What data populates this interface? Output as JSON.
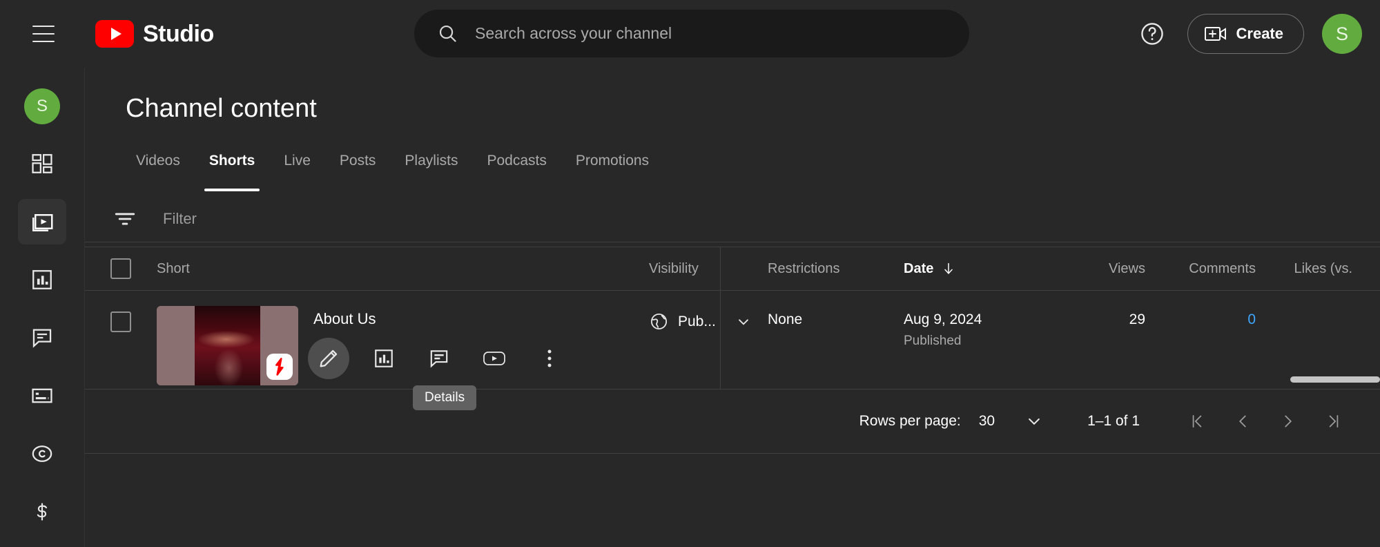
{
  "app": {
    "brand_name": "Studio",
    "hamburger_label": "Guide menu"
  },
  "search": {
    "placeholder": "Search across your channel",
    "value": ""
  },
  "header_actions": {
    "help_label": "Help",
    "create_label": "Create",
    "avatar_initial": "S"
  },
  "rail": {
    "avatar_initial": "S",
    "items": [
      {
        "name": "dashboard",
        "label": "Dashboard",
        "active": false
      },
      {
        "name": "content",
        "label": "Content",
        "active": true
      },
      {
        "name": "analytics",
        "label": "Analytics",
        "active": false
      },
      {
        "name": "comments",
        "label": "Comments",
        "active": false
      },
      {
        "name": "subtitles",
        "label": "Subtitles",
        "active": false
      },
      {
        "name": "copyright",
        "label": "Copyright",
        "active": false
      },
      {
        "name": "earn",
        "label": "Earn",
        "active": false
      }
    ]
  },
  "page": {
    "title": "Channel content"
  },
  "tabs": [
    {
      "label": "Videos",
      "active": false
    },
    {
      "label": "Shorts",
      "active": true
    },
    {
      "label": "Live",
      "active": false
    },
    {
      "label": "Posts",
      "active": false
    },
    {
      "label": "Playlists",
      "active": false
    },
    {
      "label": "Podcasts",
      "active": false
    },
    {
      "label": "Promotions",
      "active": false
    }
  ],
  "filter": {
    "placeholder": "Filter",
    "value": ""
  },
  "table": {
    "columns": {
      "short": "Short",
      "visibility": "Visibility",
      "restrictions": "Restrictions",
      "date": "Date",
      "views": "Views",
      "comments": "Comments",
      "likes": "Likes (vs."
    },
    "sort": {
      "column": "Date",
      "direction": "descending"
    },
    "rows": [
      {
        "title": "About Us",
        "visibility": "Pub...",
        "visibility_full": "Public",
        "restrictions": "None",
        "date": "Aug 9, 2024",
        "date_status": "Published",
        "views": "29",
        "comments": "0",
        "selected": false,
        "actions": [
          "details",
          "analytics",
          "comments",
          "watch-on-youtube",
          "more-options"
        ]
      }
    ]
  },
  "tooltip": {
    "text": "Details"
  },
  "pagination": {
    "rows_per_page_label": "Rows per page:",
    "rows_per_page_value": "30",
    "range": "1–1 of 1",
    "first_label": "First page",
    "prev_label": "Previous page",
    "next_label": "Next page",
    "last_label": "Last page"
  },
  "colors": {
    "background": "#282828",
    "search_bg": "#1a1a1a",
    "accent_red": "#ff0000",
    "avatar_green": "#62ac3f",
    "link_blue": "#3ea6ff",
    "tooltip_bg": "#616161",
    "muted_text": "#aaaaaa"
  }
}
